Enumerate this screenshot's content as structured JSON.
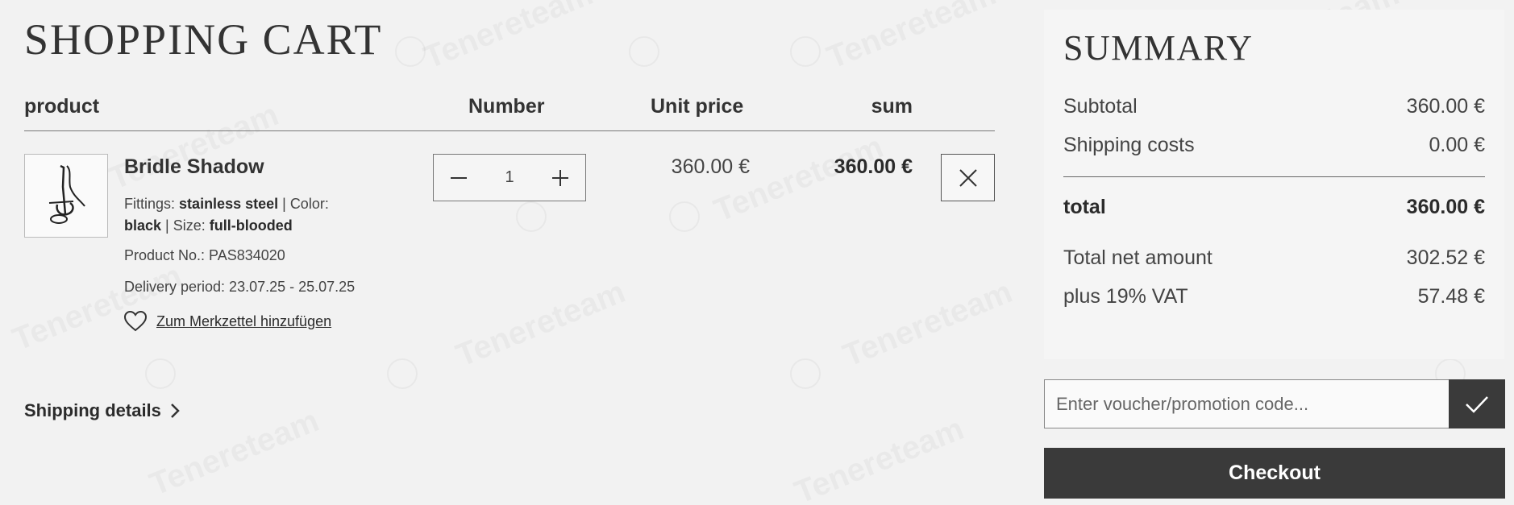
{
  "header": {
    "title": "SHOPPING CART"
  },
  "table": {
    "columns": {
      "product": "product",
      "number": "Number",
      "unit_price": "Unit price",
      "sum": "sum"
    }
  },
  "item": {
    "name": "Bridle Shadow",
    "fittings_label": "Fittings:",
    "fittings_value": "stainless steel",
    "color_label": "Color:",
    "color_value": "black",
    "size_label": "Size:",
    "size_value": "full-blooded",
    "product_no": "Product No.: PAS834020",
    "delivery": "Delivery period: 23.07.25 - 25.07.25",
    "wishlist_label": "Zum Merkzettel hinzufügen",
    "quantity": "1",
    "unit_price": "360.00 €",
    "sum": "360.00 €"
  },
  "shipping_details_label": "Shipping details",
  "summary": {
    "title": "SUMMARY",
    "subtotal_label": "Subtotal",
    "subtotal_value": "360.00 €",
    "shipping_label": "Shipping costs",
    "shipping_value": "0.00 €",
    "total_label": "total",
    "total_value": "360.00 €",
    "net_label": "Total net amount",
    "net_value": "302.52 €",
    "vat_label": "plus 19% VAT",
    "vat_value": "57.48 €"
  },
  "voucher": {
    "placeholder": "Enter voucher/promotion code..."
  },
  "checkout_label": "Checkout",
  "watermark": {
    "text": "Tenereteam"
  },
  "icons": {
    "decrement": "minus-icon",
    "increment": "plus-icon",
    "remove": "close-icon",
    "wishlist": "heart-icon",
    "shipping": "chevron-right-icon",
    "apply": "checkmark-icon"
  },
  "colors": {
    "accent": "#3a3a3a",
    "background": "#f2f2f2"
  }
}
